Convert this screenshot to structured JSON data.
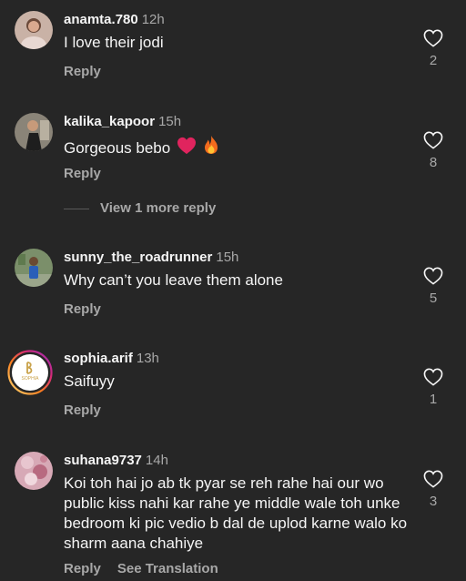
{
  "comments": [
    {
      "username": "anamta.780",
      "time": "12h",
      "text": "I love their jodi",
      "reply_label": "Reply",
      "likes": "2",
      "avatar_icon": "user-photo-avatar"
    },
    {
      "username": "kalika_kapoor",
      "time": "15h",
      "text": "Gorgeous bebo",
      "emojis": [
        "red-heart-emoji",
        "fire-emoji"
      ],
      "reply_label": "Reply",
      "likes": "8",
      "avatar_icon": "user-photo-avatar",
      "view_more": "View 1 more reply"
    },
    {
      "username": "sunny_the_roadrunner",
      "time": "15h",
      "text": "Why can’t you leave them alone",
      "reply_label": "Reply",
      "likes": "5",
      "avatar_icon": "user-photo-avatar"
    },
    {
      "username": "sophia.arif",
      "time": "13h",
      "text": "Saifuyy",
      "reply_label": "Reply",
      "likes": "1",
      "avatar_icon": "sophia-logo-avatar",
      "avatar_text": "SOPHIA"
    },
    {
      "username": "suhana9737",
      "time": "14h",
      "text": "Koi toh hai jo ab tk pyar se reh rahe hai our wo public kiss nahi kar rahe ye middle wale toh unke bedroom ki pic vedio b dal de uplod karne walo ko sharm aana chahiye",
      "reply_label": "Reply",
      "see_translation": "See Translation",
      "likes": "3",
      "avatar_icon": "user-photo-avatar"
    }
  ],
  "colors": {
    "background": "#262626",
    "primary_text": "#f5f5f5",
    "secondary_text": "#a8a8a8",
    "heart_red": "#e0245e",
    "story_ring": "#d6249f"
  }
}
